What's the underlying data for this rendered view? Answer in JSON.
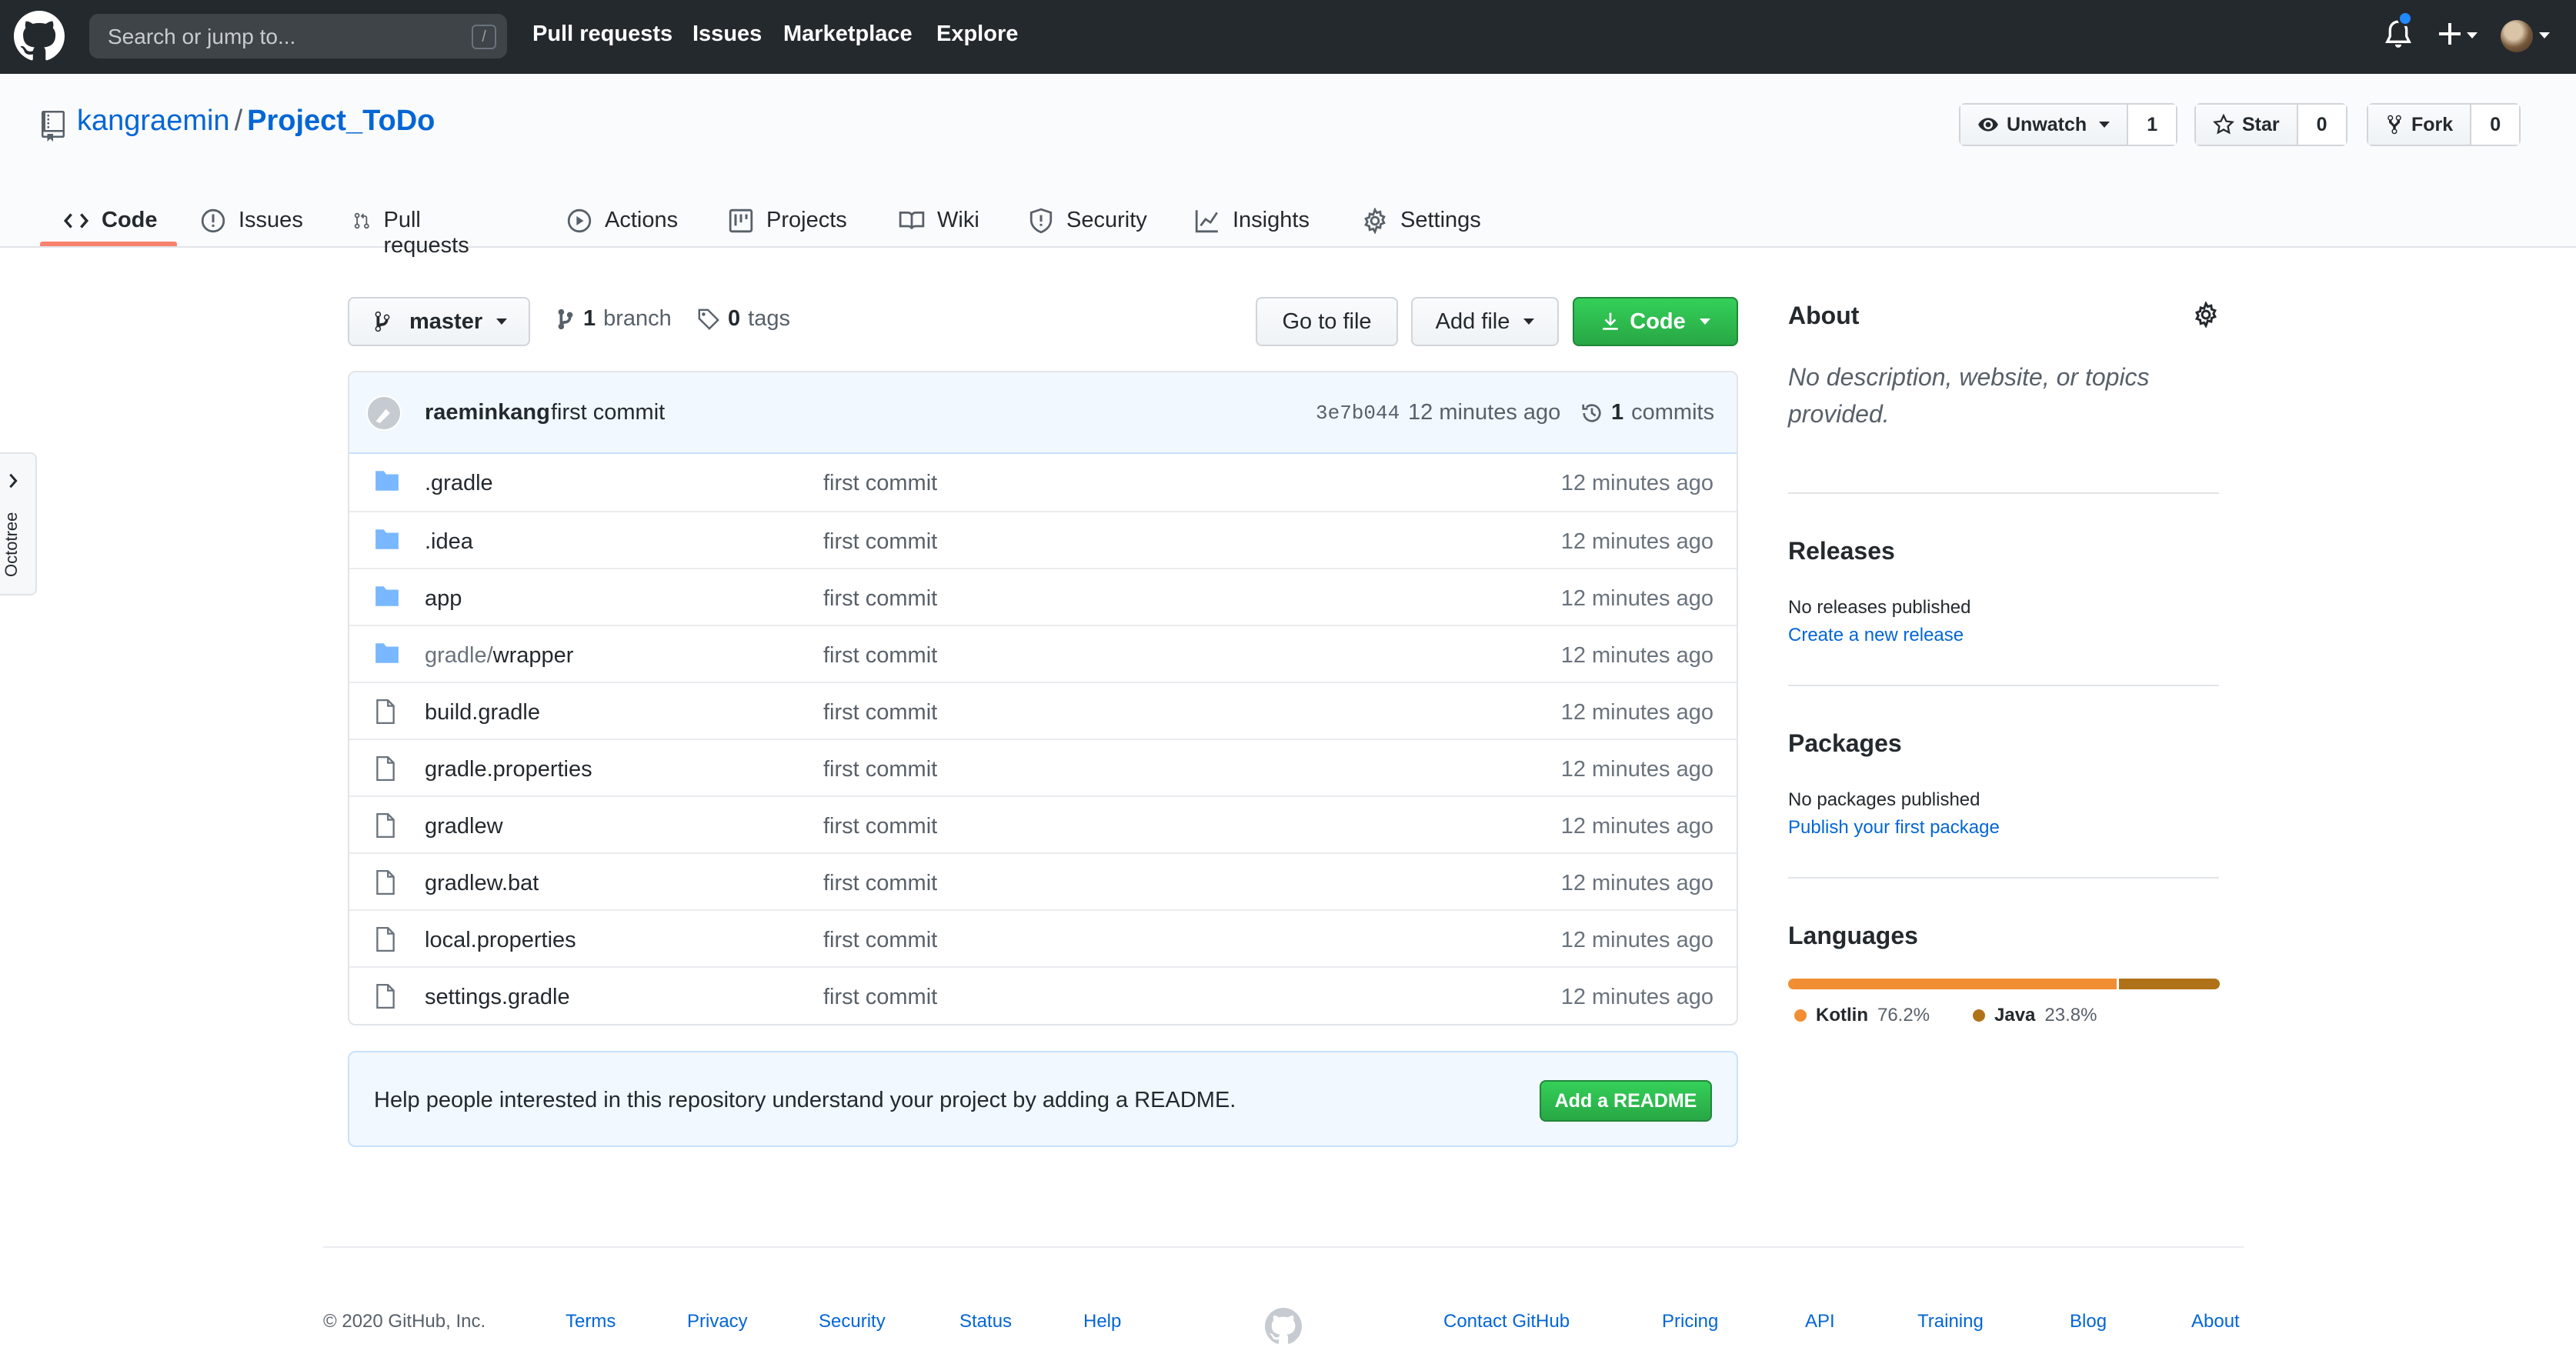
{
  "header": {
    "search_placeholder": "Search or jump to...",
    "search_shortcut": "/",
    "nav": [
      "Pull requests",
      "Issues",
      "Marketplace",
      "Explore"
    ]
  },
  "repo": {
    "owner": "kangraemin",
    "separator": "/",
    "name": "Project_ToDo",
    "watch": {
      "label": "Unwatch",
      "count": "1"
    },
    "star": {
      "label": "Star",
      "count": "0"
    },
    "fork": {
      "label": "Fork",
      "count": "0"
    }
  },
  "tabs": [
    {
      "label": "Code",
      "icon": "code-icon",
      "selected": true
    },
    {
      "label": "Issues",
      "icon": "issue-icon"
    },
    {
      "label": "Pull requests",
      "icon": "pull-request-icon"
    },
    {
      "label": "Actions",
      "icon": "play-icon"
    },
    {
      "label": "Projects",
      "icon": "project-icon"
    },
    {
      "label": "Wiki",
      "icon": "book-icon"
    },
    {
      "label": "Security",
      "icon": "shield-icon"
    },
    {
      "label": "Insights",
      "icon": "graph-icon"
    },
    {
      "label": "Settings",
      "icon": "gear-icon"
    }
  ],
  "toolbar": {
    "branch": "master",
    "branches_count": "1",
    "branches_label": "branch",
    "tags_count": "0",
    "tags_label": "tags",
    "goto_file": "Go to file",
    "add_file": "Add file",
    "code": "Code"
  },
  "latest_commit": {
    "author": "raeminkang",
    "message": "first commit",
    "sha": "3e7b044",
    "age": "12 minutes ago",
    "commits_count": "1",
    "commits_label": "commits"
  },
  "files": [
    {
      "type": "dir",
      "prefix": "",
      "name": ".gradle",
      "message": "first commit",
      "age": "12 minutes ago"
    },
    {
      "type": "dir",
      "prefix": "",
      "name": ".idea",
      "message": "first commit",
      "age": "12 minutes ago"
    },
    {
      "type": "dir",
      "prefix": "",
      "name": "app",
      "message": "first commit",
      "age": "12 minutes ago"
    },
    {
      "type": "dir",
      "prefix": "gradle/",
      "name": "wrapper",
      "message": "first commit",
      "age": "12 minutes ago"
    },
    {
      "type": "file",
      "prefix": "",
      "name": "build.gradle",
      "message": "first commit",
      "age": "12 minutes ago"
    },
    {
      "type": "file",
      "prefix": "",
      "name": "gradle.properties",
      "message": "first commit",
      "age": "12 minutes ago"
    },
    {
      "type": "file",
      "prefix": "",
      "name": "gradlew",
      "message": "first commit",
      "age": "12 minutes ago"
    },
    {
      "type": "file",
      "prefix": "",
      "name": "gradlew.bat",
      "message": "first commit",
      "age": "12 minutes ago"
    },
    {
      "type": "file",
      "prefix": "",
      "name": "local.properties",
      "message": "first commit",
      "age": "12 minutes ago"
    },
    {
      "type": "file",
      "prefix": "",
      "name": "settings.gradle",
      "message": "first commit",
      "age": "12 minutes ago"
    }
  ],
  "readme_prompt": {
    "text": "Help people interested in this repository understand your project by adding a README.",
    "button": "Add a README"
  },
  "sidebar": {
    "about_title": "About",
    "about_desc": "No description, website, or topics provided.",
    "releases_title": "Releases",
    "releases_text": "No releases published",
    "releases_link": "Create a new release",
    "packages_title": "Packages",
    "packages_text": "No packages published",
    "packages_link": "Publish your first package",
    "languages_title": "Languages",
    "languages": [
      {
        "name": "Kotlin",
        "percent": "76.2%",
        "value": 76.2,
        "color": "#F18E33"
      },
      {
        "name": "Java",
        "percent": "23.8%",
        "value": 23.8,
        "color": "#B07219"
      }
    ]
  },
  "octotree": {
    "label": "Octotree"
  },
  "footer": {
    "copyright": "© 2020 GitHub, Inc.",
    "left_links": [
      "Terms",
      "Privacy",
      "Security",
      "Status",
      "Help"
    ],
    "right_links": [
      "Contact GitHub",
      "Pricing",
      "API",
      "Training",
      "Blog",
      "About"
    ]
  },
  "colors": {
    "header_bg": "#24292e",
    "link": "#0366d6",
    "green": "#28a745",
    "tab_accent": "#f9826c"
  }
}
